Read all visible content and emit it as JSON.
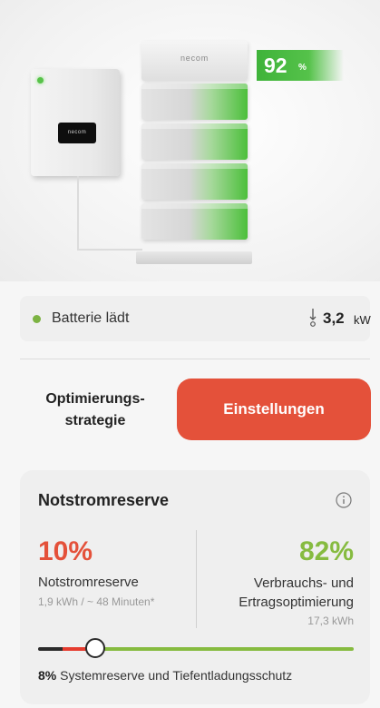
{
  "hero": {
    "battery_percent": "92",
    "battery_percent_unit": "%",
    "inverter_brand": "necom",
    "stack_brand": "necom"
  },
  "status": {
    "text": "Batterie lädt",
    "power_value": "3,2",
    "power_unit": "kW",
    "dot_color": "#7cb342"
  },
  "strategy": {
    "label_line1": "Optimierungs-",
    "label_line2": "strategie",
    "button_label": "Einstellungen",
    "button_color": "#e4513a"
  },
  "reserve": {
    "title": "Notstromreserve",
    "left": {
      "percent": "10%",
      "label": "Notstromreserve",
      "sub": "1,9 kWh / ~ 48 Minuten*",
      "color": "#e4513a"
    },
    "right": {
      "percent": "82%",
      "label_line1": "Verbrauchs- und",
      "label_line2": "Ertragsoptimierung",
      "sub": "17,3 kWh",
      "color": "#86bb40"
    },
    "slider_value": 0.18,
    "system_reserve_percent": "8%",
    "system_reserve_text": "Systemreserve und Tiefentladungsschutz"
  }
}
